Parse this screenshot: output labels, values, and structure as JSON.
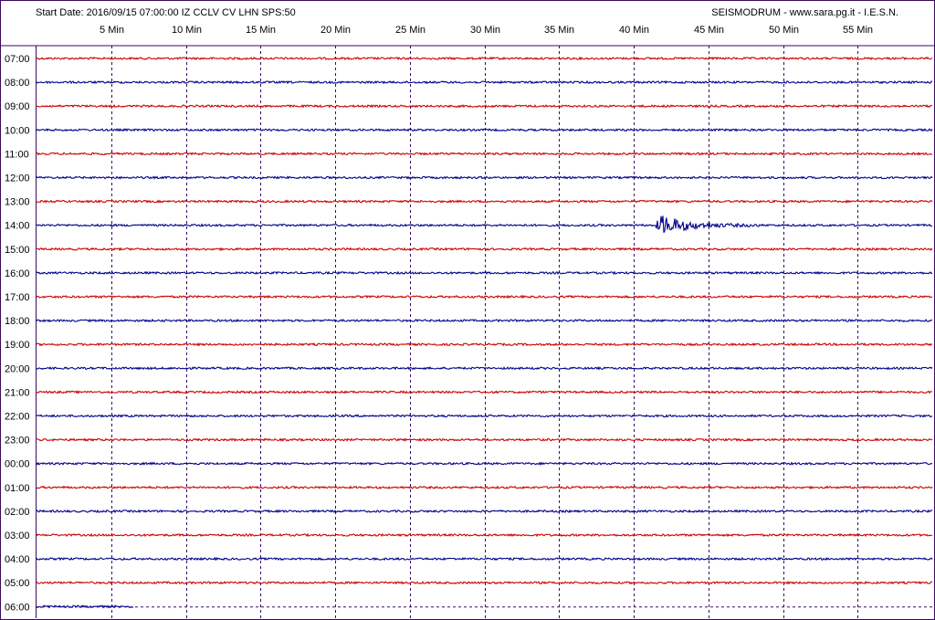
{
  "header": {
    "start_info": "Start Date: 2016/09/15 07:00:00 IZ CCLV CV LHN SPS:50",
    "credit": "SEISMODRUM - www.sara.pg.it - I.E.S.N."
  },
  "colors": {
    "trace_red": "#cc0000",
    "trace_blue": "#00008b",
    "grid": "#3a0a60",
    "frame": "#3a0a60"
  },
  "chart_data": {
    "type": "line",
    "title": "",
    "x_tick_labels": [
      "5 Min",
      "10 Min",
      "15 Min",
      "20 Min",
      "25 Min",
      "30 Min",
      "35 Min",
      "40 Min",
      "45 Min",
      "50 Min",
      "55 Min"
    ],
    "x_ticks_minutes": [
      5,
      10,
      15,
      20,
      25,
      30,
      35,
      40,
      45,
      50,
      55
    ],
    "xlim_minutes": [
      0,
      60
    ],
    "grid": true,
    "rows": [
      {
        "hour": "07:00",
        "color": "red",
        "end_minute": 60
      },
      {
        "hour": "08:00",
        "color": "blue",
        "end_minute": 60
      },
      {
        "hour": "09:00",
        "color": "red",
        "end_minute": 60
      },
      {
        "hour": "10:00",
        "color": "blue",
        "end_minute": 60
      },
      {
        "hour": "11:00",
        "color": "red",
        "end_minute": 60
      },
      {
        "hour": "12:00",
        "color": "blue",
        "end_minute": 60
      },
      {
        "hour": "13:00",
        "color": "red",
        "end_minute": 60
      },
      {
        "hour": "14:00",
        "color": "blue",
        "end_minute": 60,
        "event": {
          "start_minute": 41.5,
          "end_minute": 48.5,
          "peak_minute": 41.9
        }
      },
      {
        "hour": "15:00",
        "color": "red",
        "end_minute": 60
      },
      {
        "hour": "16:00",
        "color": "blue",
        "end_minute": 60
      },
      {
        "hour": "17:00",
        "color": "red",
        "end_minute": 60
      },
      {
        "hour": "18:00",
        "color": "blue",
        "end_minute": 60
      },
      {
        "hour": "19:00",
        "color": "red",
        "end_minute": 60
      },
      {
        "hour": "20:00",
        "color": "blue",
        "end_minute": 60
      },
      {
        "hour": "21:00",
        "color": "red",
        "end_minute": 60
      },
      {
        "hour": "22:00",
        "color": "blue",
        "end_minute": 60
      },
      {
        "hour": "23:00",
        "color": "red",
        "end_minute": 60
      },
      {
        "hour": "00:00",
        "color": "blue",
        "end_minute": 60
      },
      {
        "hour": "01:00",
        "color": "red",
        "end_minute": 60
      },
      {
        "hour": "02:00",
        "color": "blue",
        "end_minute": 60
      },
      {
        "hour": "03:00",
        "color": "red",
        "end_minute": 60
      },
      {
        "hour": "04:00",
        "color": "blue",
        "end_minute": 60
      },
      {
        "hour": "05:00",
        "color": "red",
        "end_minute": 60
      },
      {
        "hour": "06:00",
        "color": "blue",
        "end_minute": 6.5
      }
    ]
  }
}
